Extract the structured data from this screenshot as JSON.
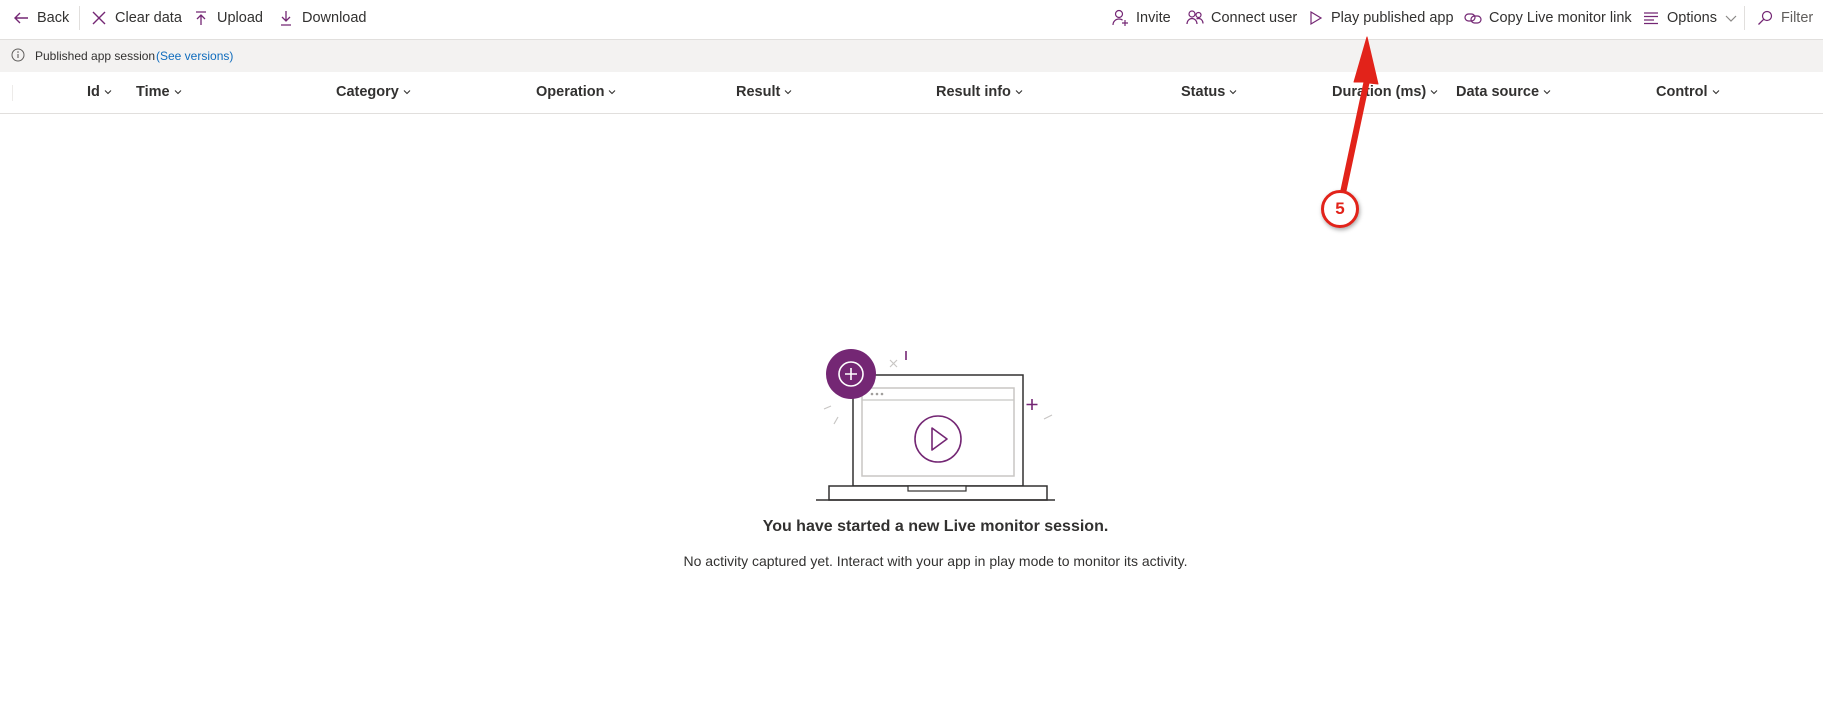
{
  "toolbar": {
    "back": "Back",
    "clear_data": "Clear data",
    "upload": "Upload",
    "download": "Download",
    "invite": "Invite",
    "connect_user": "Connect user",
    "play_published_app": "Play published app",
    "copy_link": "Copy Live monitor link",
    "options": "Options",
    "filter": "Filter"
  },
  "banner": {
    "message": "Published app session",
    "link": "(See versions)"
  },
  "columns": [
    "Id",
    "Time",
    "Category",
    "Operation",
    "Result",
    "Result info",
    "Status",
    "Duration (ms)",
    "Data source",
    "Control"
  ],
  "empty_state": {
    "title": "You have started a new Live monitor session.",
    "subtitle": "No activity captured yet. Interact with your app in play mode to monitor its activity."
  },
  "annotation": {
    "step": "5"
  },
  "colors": {
    "accent": "#742774",
    "link": "#0f6cbd",
    "annotation": "#e2231a",
    "banner_bg": "#f3f2f1"
  }
}
